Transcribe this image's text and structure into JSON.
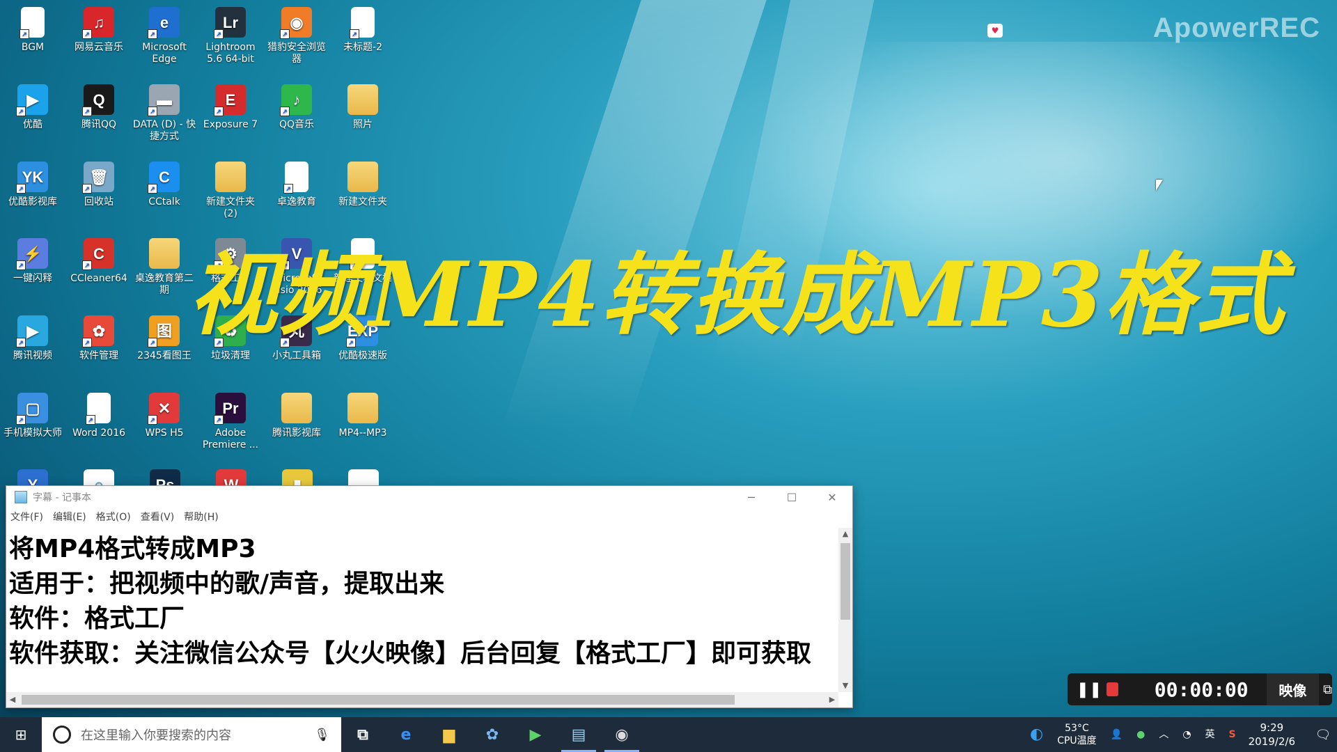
{
  "watermark": "ApowerREC",
  "title_overlay": "视频MP4转换成MP3格式",
  "desktop_icons": [
    {
      "label": "BGM",
      "glyph": "",
      "color": "#ffffff",
      "kind": "doc"
    },
    {
      "label": "网易云音乐",
      "glyph": "♫",
      "color": "#d9262b",
      "kind": "app"
    },
    {
      "label": "Microsoft Edge",
      "glyph": "e",
      "color": "#1f6fd1",
      "kind": "app"
    },
    {
      "label": "Lightroom 5.6 64-bit",
      "glyph": "Lr",
      "color": "#23313f",
      "kind": "app"
    },
    {
      "label": "猎豹安全浏览器",
      "glyph": "◉",
      "color": "#f07c27",
      "kind": "app"
    },
    {
      "label": "未标题-2",
      "glyph": "",
      "color": "#ffffff",
      "kind": "doc"
    },
    {
      "label": "优酷",
      "glyph": "▶",
      "color": "#1aa3ea",
      "kind": "app"
    },
    {
      "label": "腾讯QQ",
      "glyph": "Q",
      "color": "#1a1a1a",
      "kind": "app"
    },
    {
      "label": "DATA (D) - 快捷方式",
      "glyph": "▬",
      "color": "#9aa6b2",
      "kind": "app"
    },
    {
      "label": "Exposure 7",
      "glyph": "E",
      "color": "#d42c2c",
      "kind": "app"
    },
    {
      "label": "QQ音乐",
      "glyph": "♪",
      "color": "#2eb84c",
      "kind": "app"
    },
    {
      "label": "照片",
      "glyph": "",
      "color": "",
      "kind": "folder"
    },
    {
      "label": "优酷影视库",
      "glyph": "YK",
      "color": "#2c8fe0",
      "kind": "app"
    },
    {
      "label": "回收站",
      "glyph": "🗑",
      "color": "#7aa8c9",
      "kind": "app"
    },
    {
      "label": "CCtalk",
      "glyph": "C",
      "color": "#1b8ff0",
      "kind": "app"
    },
    {
      "label": "新建文件夹 (2)",
      "glyph": "",
      "color": "",
      "kind": "folder"
    },
    {
      "label": "卓逸教育",
      "glyph": "",
      "color": "#ffffff",
      "kind": "doc"
    },
    {
      "label": "新建文件夹",
      "glyph": "",
      "color": "",
      "kind": "folder"
    },
    {
      "label": "一键闪释",
      "glyph": "⚡",
      "color": "#5b7de0",
      "kind": "app"
    },
    {
      "label": "CCleaner64",
      "glyph": "C",
      "color": "#d6322a",
      "kind": "app"
    },
    {
      "label": "桌逸教育第二期",
      "glyph": "",
      "color": "",
      "kind": "folder"
    },
    {
      "label": "格式工厂",
      "glyph": "⚙",
      "color": "#7d8a96",
      "kind": "app"
    },
    {
      "label": "Microsoft Visio 2016",
      "glyph": "V",
      "color": "#3856b0",
      "kind": "app"
    },
    {
      "label": "新建文本文档",
      "glyph": "",
      "color": "#ffffff",
      "kind": "doc"
    },
    {
      "label": "腾讯视频",
      "glyph": "▶",
      "color": "#29a8e0",
      "kind": "app"
    },
    {
      "label": "软件管理",
      "glyph": "✿",
      "color": "#e84a3a",
      "kind": "app"
    },
    {
      "label": "2345看图王",
      "glyph": "图",
      "color": "#f0a020",
      "kind": "app"
    },
    {
      "label": "垃圾清理",
      "glyph": "♻",
      "color": "#2eae4c",
      "kind": "app"
    },
    {
      "label": "小丸工具箱",
      "glyph": "丸",
      "color": "#3a2a4a",
      "kind": "app"
    },
    {
      "label": "优酷极速版",
      "glyph": "EXP",
      "color": "#2c8fe0",
      "kind": "app"
    },
    {
      "label": "手机模拟大师",
      "glyph": "▢",
      "color": "#3a8fe0",
      "kind": "app"
    },
    {
      "label": "Word 2016",
      "glyph": "",
      "color": "#ffffff",
      "kind": "doc"
    },
    {
      "label": "WPS H5",
      "glyph": "✕",
      "color": "#e23a3a",
      "kind": "app"
    },
    {
      "label": "Adobe Premiere ...",
      "glyph": "Pr",
      "color": "#2a0f3c",
      "kind": "app"
    },
    {
      "label": "腾讯影视库",
      "glyph": "",
      "color": "",
      "kind": "folder"
    },
    {
      "label": "MP4--MP3",
      "glyph": "",
      "color": "",
      "kind": "folder"
    }
  ],
  "bottom_row_icons": [
    {
      "glyph": "Y",
      "color": "#2c6fd0"
    },
    {
      "glyph": "○",
      "color": "#ffffff"
    },
    {
      "glyph": "Ps",
      "color": "#0f2b45"
    },
    {
      "glyph": "W",
      "color": "#e23a3a"
    },
    {
      "glyph": "▮",
      "color": "#e8c83a"
    },
    {
      "glyph": "",
      "color": "#ffffff"
    }
  ],
  "notepad": {
    "title": "字幕 - 记事本",
    "menu": [
      "文件(F)",
      "编辑(E)",
      "格式(O)",
      "查看(V)",
      "帮助(H)"
    ],
    "lines": [
      "将MP4格式转成MP3",
      "适用于：把视频中的歌/声音，提取出来",
      "软件：格式工厂",
      "软件获取：关注微信公众号【火火映像】后台回复【格式工厂】即可获取"
    ]
  },
  "recorder": {
    "time": "00:00:00",
    "badge": "映像"
  },
  "taskbar": {
    "search_placeholder": "在这里输入你要搜索的内容",
    "cpu_temp": "53°C",
    "cpu_label": "CPU温度",
    "ime": "英",
    "time": "9:29",
    "date": "2019/2/6"
  }
}
